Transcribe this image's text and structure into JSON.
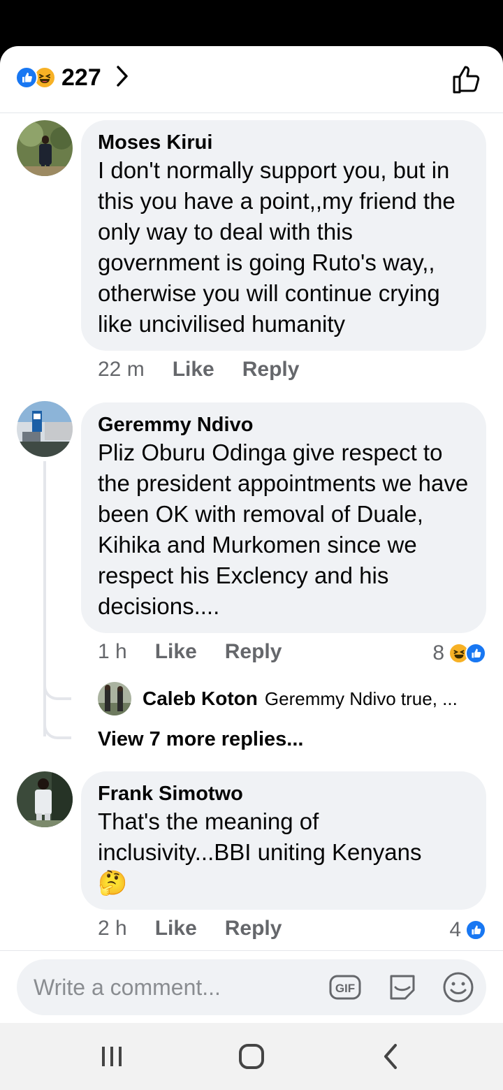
{
  "header": {
    "reaction_count": "227",
    "reaction_icons": [
      "like-icon",
      "haha-icon"
    ]
  },
  "comments": [
    {
      "author": "Moses Kirui",
      "text": "I don't normally support you, but in this you have a point,,my friend the only way to deal with this government is going Ruto's way,, otherwise you will continue crying like uncivilised humanity",
      "time": "22 m",
      "like": "Like",
      "reply": "Reply"
    },
    {
      "author": "Geremmy Ndivo",
      "text": "Pliz Oburu Odinga give respect to the president appointments we have been OK with removal of Duale, Kihika and Murkomen since we respect his Exclency and his decisions....",
      "time": "1 h",
      "like": "Like",
      "reply": "Reply",
      "reactions": "8",
      "reply_preview": {
        "author": "Caleb Koton",
        "snippet": "Geremmy Ndivo true, ..."
      },
      "view_more": "View 7 more replies..."
    },
    {
      "author": "Frank Simotwo",
      "text": "That's the meaning of inclusivity...BBI uniting Kenyans",
      "emoji": "🤔",
      "time": "2 h",
      "like": "Like",
      "reply": "Reply",
      "reactions": "4"
    }
  ],
  "composer": {
    "placeholder": "Write a comment..."
  },
  "colors": {
    "accent": "#1877f2",
    "haha": "#f7b125",
    "bubble": "#f0f2f5",
    "muted": "#65676b"
  }
}
